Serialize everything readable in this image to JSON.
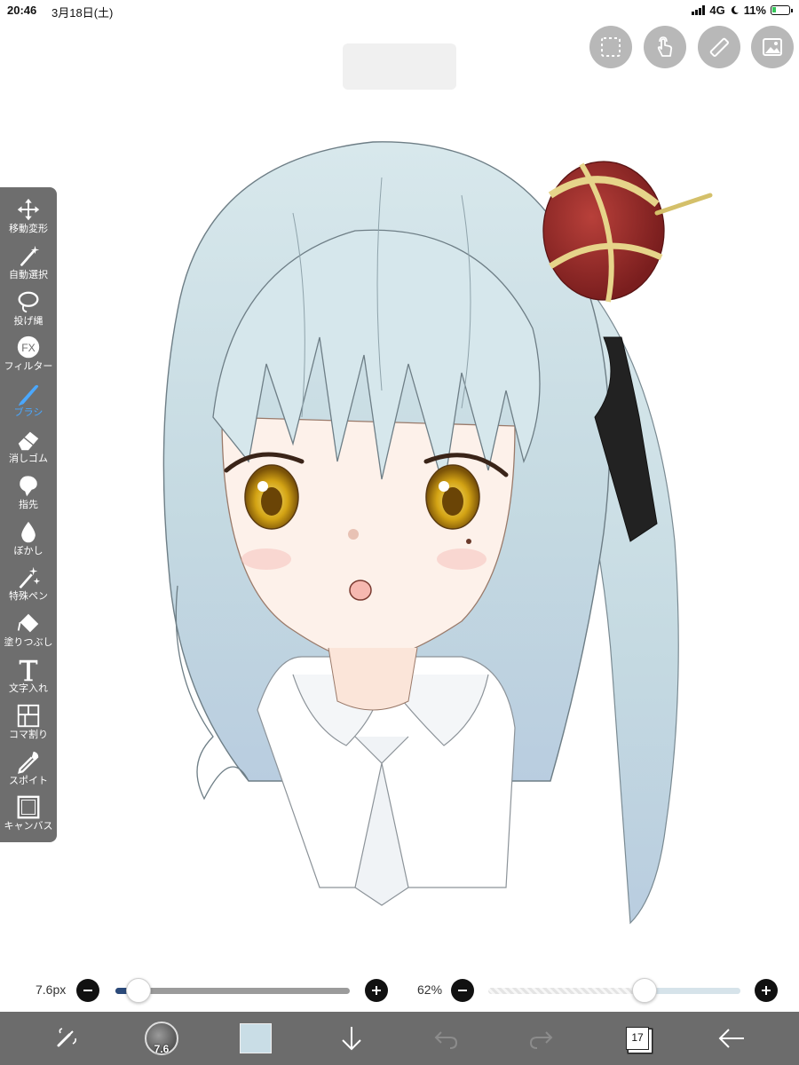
{
  "status_bar": {
    "time": "20:46",
    "date": "3月18日(土)",
    "network": "4G",
    "battery": "11%"
  },
  "top_buttons": [
    {
      "name": "selection-button",
      "icon": "dashed-square-icon"
    },
    {
      "name": "touch-gesture-button",
      "icon": "touch-hand-icon"
    },
    {
      "name": "ruler-button",
      "icon": "ruler-icon"
    },
    {
      "name": "material-button",
      "icon": "image-icon"
    }
  ],
  "toolbar": {
    "items": [
      {
        "label": "移動変形",
        "icon": "move-arrows-icon"
      },
      {
        "label": "自動選択",
        "icon": "magic-wand-icon"
      },
      {
        "label": "投げ縄",
        "icon": "lasso-icon"
      },
      {
        "label": "フィルター",
        "icon": "fx-icon"
      },
      {
        "label": "ブラシ",
        "icon": "brush-icon",
        "active": true
      },
      {
        "label": "消しゴム",
        "icon": "eraser-icon"
      },
      {
        "label": "指先",
        "icon": "finger-smudge-icon"
      },
      {
        "label": "ぼかし",
        "icon": "droplet-icon"
      },
      {
        "label": "特殊ペン",
        "icon": "sparkle-pen-icon"
      },
      {
        "label": "塗りつぶし",
        "icon": "paint-bucket-icon"
      },
      {
        "label": "文字入れ",
        "icon": "text-icon"
      },
      {
        "label": "コマ割り",
        "icon": "panel-divide-icon"
      },
      {
        "label": "スポイト",
        "icon": "eyedropper-icon"
      },
      {
        "label": "キャンバス",
        "icon": "canvas-icon"
      }
    ]
  },
  "brush_size": {
    "value_label": "7.6px",
    "fraction": 0.1
  },
  "opacity": {
    "value_label": "62%",
    "fraction": 0.62
  },
  "bottom_bar": {
    "brush_preview_size": "7.6",
    "layer_count": "17",
    "current_color": "#c9dde6"
  },
  "colors": {
    "toolbar_bg": "#6e6e6e",
    "accent": "#4aa8ff",
    "hair": "#cfe2e8",
    "crown": "#9e2b2b",
    "eyes": "#d4a414"
  }
}
